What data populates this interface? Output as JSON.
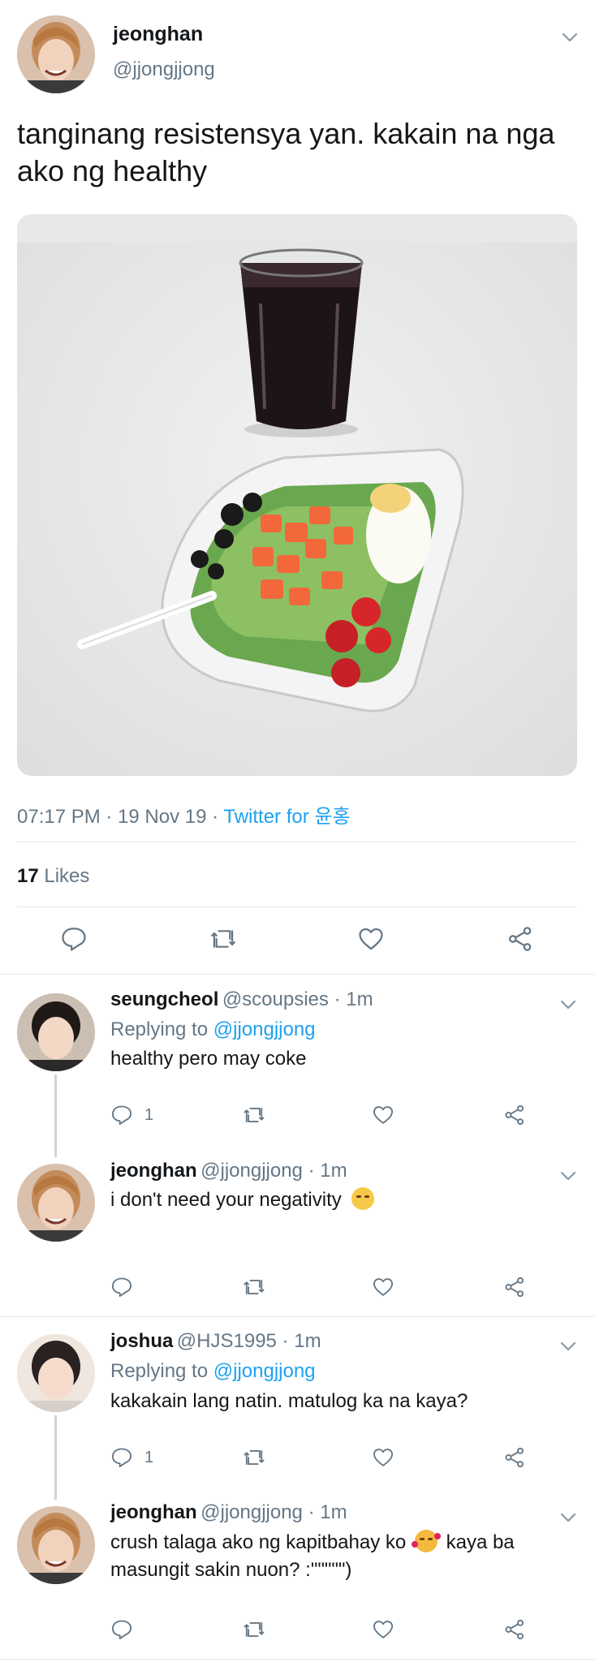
{
  "main_tweet": {
    "display_name": "jeonghan",
    "handle": "@jjongjjong",
    "text_line1": "tanginang resistensya yan. kakain na nga",
    "text_line2": "ako ng healthy",
    "timestamp": "07:17 PM · 19 Nov 19 · ",
    "source": "Twitter for 윤홍",
    "likes_count": "17",
    "likes_label": "Likes"
  },
  "replies": [
    {
      "display_name": "seungcheol",
      "handle_time": "@scoupsies · 1m",
      "replying_label": "Replying to ",
      "replying_to": "@jjongjjong",
      "text": "healthy pero may coke",
      "reply_count": "1"
    },
    {
      "display_name": "jeonghan",
      "handle_time": "@jjongjjong · 1m",
      "text": "i don't need your negativity"
    },
    {
      "display_name": "joshua",
      "handle_time": "@HJS1995 · 1m",
      "replying_label": "Replying to ",
      "replying_to": "@jjongjjong",
      "text": "kakakain lang natin. matulog ka na kaya?",
      "reply_count": "1"
    },
    {
      "display_name": "jeonghan",
      "handle_time": "@jjongjjong · 1m",
      "text_line1a": "crush talaga ako ng kapitbahay ko",
      "text_line1b": "kaya ba",
      "text_line2": "masungit sakin nuon? :\"\"\"\"\")"
    }
  ],
  "colors": {
    "accent": "#1da1f2",
    "secondary_text": "#657786",
    "divider": "#e1e8ed",
    "icon": "#657786"
  },
  "icons": [
    "chevron-down-icon",
    "reply-icon",
    "retweet-icon",
    "like-icon",
    "share-icon"
  ]
}
